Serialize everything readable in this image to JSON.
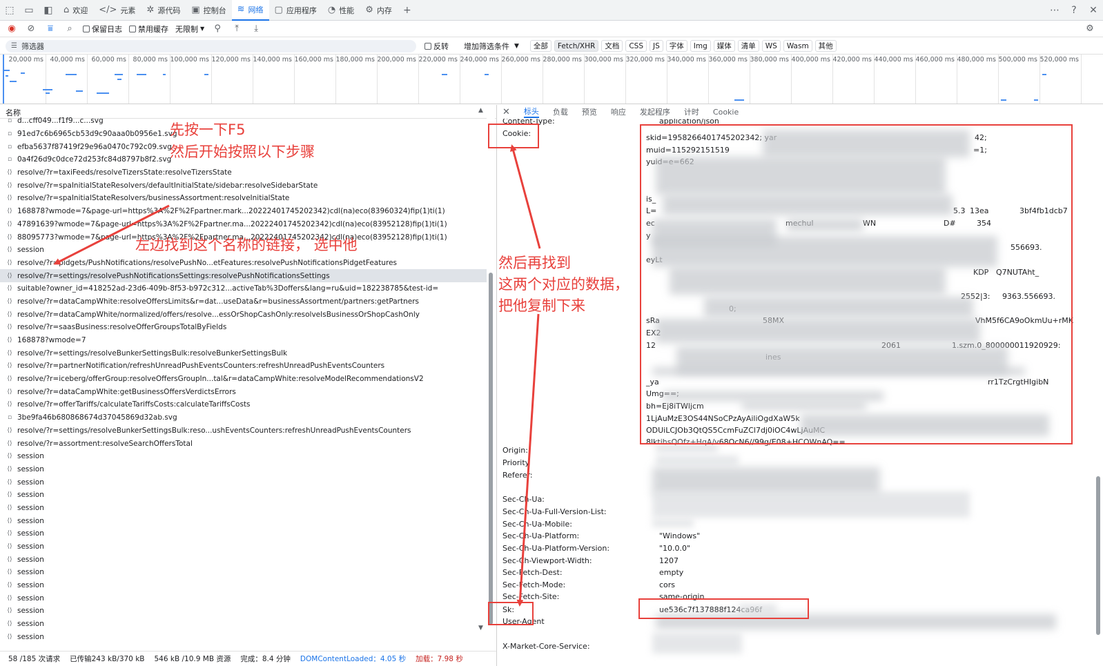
{
  "main_tabs": [
    {
      "label": "欢迎",
      "icon": "home-icon"
    },
    {
      "label": "元素",
      "icon": "code-icon"
    },
    {
      "label": "源代码",
      "icon": "bug-icon"
    },
    {
      "label": "控制台",
      "icon": "console-icon"
    },
    {
      "label": "网络",
      "icon": "wifi-icon"
    },
    {
      "label": "应用程序",
      "icon": "window-icon"
    },
    {
      "label": "性能",
      "icon": "gauge-icon"
    },
    {
      "label": "内存",
      "icon": "memory-icon"
    }
  ],
  "active_tab": "网络",
  "toolbar": {
    "preserve_log": "保留日志",
    "disable_cache": "禁用缓存",
    "throttle": "无限制"
  },
  "filter": {
    "placeholder": "筛选器",
    "invert": "反转",
    "more_filters": "增加筛选条件",
    "types": [
      "全部",
      "Fetch/XHR",
      "文档",
      "CSS",
      "JS",
      "字体",
      "Img",
      "媒体",
      "清单",
      "WS",
      "Wasm",
      "其他"
    ]
  },
  "timeline_ticks": [
    "20,000 ms",
    "40,000 ms",
    "60,000 ms",
    "80,000 ms",
    "100,000 ms",
    "120,000 ms",
    "140,000 ms",
    "160,000 ms",
    "180,000 ms",
    "200,000 ms",
    "220,000 ms",
    "240,000 ms",
    "260,000 ms",
    "280,000 ms",
    "300,000 ms",
    "320,000 ms",
    "340,000 ms",
    "360,000 ms",
    "380,000 ms",
    "400,000 ms",
    "420,000 ms",
    "440,000 ms",
    "460,000 ms",
    "480,000 ms",
    "500,000 ms",
    "520,000 ms"
  ],
  "list_header": "名称",
  "requests": [
    {
      "name": "d...cff049...f1f9...c...svg",
      "type": "img"
    },
    {
      "name": "91ed7c6b6965cb53d9c90aaa0b0956e1.svg",
      "type": "img"
    },
    {
      "name": "efba5637f87419f29e96a0470c792c09.svg",
      "type": "img"
    },
    {
      "name": "0a4f26d9c0dce72d253fc84d8797b8f2.svg",
      "type": "img"
    },
    {
      "name": "resolve/?r=taxiFeeds/resolveTizersState:resolveTizersState",
      "type": "xhr"
    },
    {
      "name": "resolve/?r=spaInitialStateResolvers/defaultInitialState/sidebar:resolveSidebarState",
      "type": "xhr"
    },
    {
      "name": "resolve/?r=spaInitialStateResolvers/businessAssortment:resolveInitialState",
      "type": "xhr"
    },
    {
      "name": "168878?wmode=7&page-url=https%3A%2F%2Fpartner.mark...20222401745202342)cdl(na)eco(83960324)fip(1)ti(1)",
      "type": "xhr"
    },
    {
      "name": "47891639?wmode=7&page-url=https%3A%2F%2Fpartner.ma...20222401745202342)cdl(na)eco(83952128)fip(1)ti(1)",
      "type": "xhr"
    },
    {
      "name": "88095773?wmode=7&page-url=https%3A%2F%2Fpartner.ma...20222401745202342)cdl(na)eco(83952128)fip(1)ti(1)",
      "type": "xhr"
    },
    {
      "name": "session",
      "type": "xhr"
    },
    {
      "name": "resolve/?r=pidgets/PushNotifications/resolvePushNo...etFeatures:resolvePushNotificationsPidgetFeatures",
      "type": "xhr"
    },
    {
      "name": "resolve/?r=settings/resolvePushNotificationsSettings:resolvePushNotificationsSettings",
      "type": "xhr",
      "selected": true
    },
    {
      "name": "suitable?owner_id=418252ad-23d6-409b-8f53-b972c312...activeTab%3Doffers&lang=ru&uid=182238785&test-id=",
      "type": "xhr"
    },
    {
      "name": "resolve/?r=dataCampWhite:resolveOffersLimits&r=dat...useData&r=businessAssortment/partners:getPartners",
      "type": "xhr"
    },
    {
      "name": "resolve/?r=dataCampWhite/normalized/offers/resolve...essOrShopCashOnly:resolveIsBusinessOrShopCashOnly",
      "type": "xhr"
    },
    {
      "name": "resolve/?r=saasBusiness:resolveOfferGroupsTotalByFields",
      "type": "xhr"
    },
    {
      "name": "168878?wmode=7",
      "type": "xhr"
    },
    {
      "name": "resolve/?r=settings/resolveBunkerSettingsBulk:resolveBunkerSettingsBulk",
      "type": "xhr"
    },
    {
      "name": "resolve/?r=partnerNotification/refreshUnreadPushEventsCounters:refreshUnreadPushEventsCounters",
      "type": "xhr"
    },
    {
      "name": "resolve/?r=iceberg/offerGroup:resolveOffersGroupIn...tal&r=dataCampWhite:resolveModelRecommendationsV2",
      "type": "xhr"
    },
    {
      "name": "resolve/?r=dataCampWhite:getBusinessOffersVerdictsErrors",
      "type": "xhr"
    },
    {
      "name": "resolve/?r=offerTariffs/calculateTariffsCosts:calculateTariffsCosts",
      "type": "xhr"
    },
    {
      "name": "3be9fa46b680868674d37045869d32ab.svg",
      "type": "img"
    },
    {
      "name": "resolve/?r=settings/resolveBunkerSettingsBulk:reso...ushEventsCounters:refreshUnreadPushEventsCounters",
      "type": "xhr"
    },
    {
      "name": "resolve/?r=assortment:resolveSearchOffersTotal",
      "type": "xhr"
    },
    {
      "name": "session",
      "type": "xhr"
    },
    {
      "name": "session",
      "type": "xhr"
    },
    {
      "name": "session",
      "type": "xhr"
    },
    {
      "name": "session",
      "type": "xhr"
    },
    {
      "name": "session",
      "type": "xhr"
    },
    {
      "name": "session",
      "type": "xhr"
    },
    {
      "name": "session",
      "type": "xhr"
    },
    {
      "name": "session",
      "type": "xhr"
    },
    {
      "name": "session",
      "type": "xhr"
    },
    {
      "name": "session",
      "type": "xhr"
    },
    {
      "name": "session",
      "type": "xhr"
    },
    {
      "name": "session",
      "type": "xhr"
    },
    {
      "name": "session",
      "type": "xhr"
    },
    {
      "name": "session",
      "type": "xhr"
    },
    {
      "name": "session",
      "type": "xhr"
    }
  ],
  "status": {
    "requests": "58 /185 次请求",
    "transferred": "已传输243 kB/370 kB",
    "resources": "546 kB /10.9 MB 资源",
    "finish": "完成：8.4 分钟",
    "dcl": "DOMContentLoaded：4.05 秒",
    "load": "加载：7.98 秒"
  },
  "detail_tabs": [
    "标头",
    "负载",
    "预览",
    "响应",
    "发起程序",
    "计时",
    "Cookie"
  ],
  "active_detail_tab": "标头",
  "headers": {
    "content_type_name": "Content-Type:",
    "content_type_value": "application/json",
    "cookie_name": "Cookie:",
    "cookie_lines": [
      "skid=1958266401745202342; yar",
      "muid=115292151519",
      "yuid=e=662",
      "is_",
      "L=",
      "ec",
      "y",
      "eyLt",
      "sRa",
      "EX2",
      "12",
      "_ya",
      "Umg==;",
      "bh=Ej8iTWljcm",
      "1LjAuMzE3OS44NSoCPzAyAiliOgdXaW5k",
      "ODUiLCJOb3QtQS5CcmFuZCl7dj0iOC4wLjAuMC",
      "8lktihsQOfz+HqA/v68OcN6//99g/E08+HCOWnAQ=="
    ],
    "cookie_fragments": [
      "42;",
      "=1;",
      "3bf4fb1dcb7",
      "5.3",
      "13ea",
      "354",
      "D#",
      "mechul",
      "WN",
      "556693.",
      "Q7NUTAht_",
      "KDP",
      "2552|3:",
      "9363.556693.",
      "0;",
      "58MX",
      "VhM5f6CA9oOkmUu+rMK",
      "1.szm.0_800000011920929:",
      "rr1TzCrgtHIgibN",
      "ines",
      "2061"
    ],
    "origin_name": "Origin:",
    "priority_name": "Priority",
    "referer_name": "Referer:",
    "sec_ch_ua_name": "Sec-Ch-Ua:",
    "sec_ch_ua_full_name": "Sec-Ch-Ua-Full-Version-List:",
    "sec_ch_ua_mobile_name": "Sec-Ch-Ua-Mobile:",
    "sec_ch_ua_platform_name": "Sec-Ch-Ua-Platform:",
    "sec_ch_ua_platform_value": "\"Windows\"",
    "sec_ch_ua_platform_version_name": "Sec-Ch-Ua-Platform-Version:",
    "sec_ch_ua_platform_version_value": "\"10.0.0\"",
    "sec_ch_viewport_name": "Sec-Ch-Viewport-Width:",
    "sec_ch_viewport_value": "1207",
    "sec_fetch_dest_name": "Sec-Fetch-Dest:",
    "sec_fetch_dest_value": "empty",
    "sec_fetch_mode_name": "Sec-Fetch-Mode:",
    "sec_fetch_mode_value": "cors",
    "sec_fetch_site_name": "Sec-Fetch-Site:",
    "sec_fetch_site_value": "same-origin",
    "sk_name": "Sk:",
    "sk_value": "ue536c7f137888f124ca96f",
    "user_agent_name": "User-Agent",
    "x_market_name": "X-Market-Core-Service:"
  },
  "annotations": {
    "step1_line1": "先按一下F5",
    "step1_line2": "然后开始按照以下步骤",
    "step2": "左边找到这个名称的链接， 选中他",
    "step3_line1": "然后再找到",
    "step3_line2": "这两个对应的数据，",
    "step3_line3": "把他复制下来"
  },
  "accent_color": "#1a73e8",
  "annotation_color": "#e8413c"
}
